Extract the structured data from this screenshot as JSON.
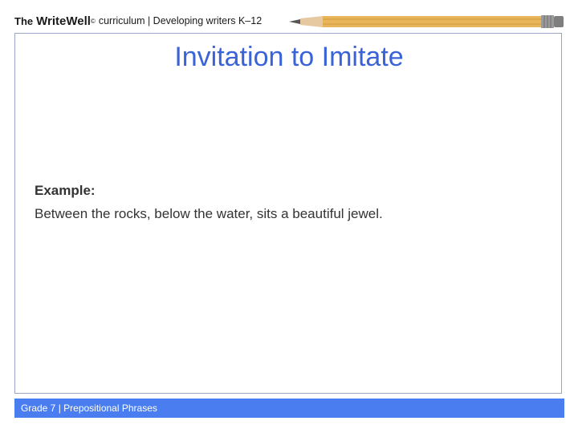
{
  "header": {
    "the": "The",
    "brand": "WriteWell",
    "brand_mark": "©",
    "tagline": "curriculum | Developing writers K–12"
  },
  "slide": {
    "title": "Invitation to Imitate",
    "example_label": "Example:",
    "example_text": "Between the rocks, below the water, sits a beautiful jewel."
  },
  "footer": {
    "text": "Grade 7 | Prepositional Phrases"
  },
  "icons": {
    "pencil": "pencil-icon"
  },
  "colors": {
    "title": "#3a63d8",
    "footer_bar": "#4a7ef0",
    "frame_border": "#9aa6c8",
    "pencil_body": "#e8b65a"
  }
}
